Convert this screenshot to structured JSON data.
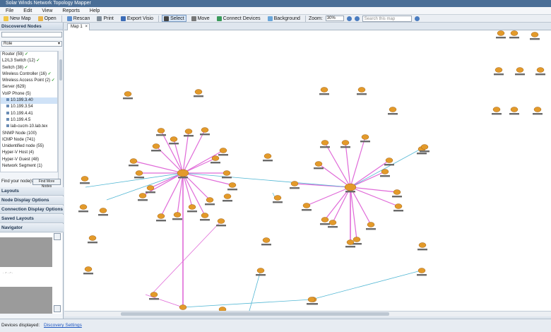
{
  "app": {
    "title": "Solar Winds Network Topology Mapper"
  },
  "menu": [
    "File",
    "Edit",
    "View",
    "Reports",
    "Help"
  ],
  "toolbar": {
    "new_map": "New Map",
    "open": "Open",
    "rescan": "Rescan",
    "print": "Print",
    "export_visio": "Export Visio",
    "select": "Select",
    "move": "Move",
    "connect_devices": "Connect Devices",
    "background": "Background",
    "zoom_label": "Zoom:",
    "zoom_value": "30%",
    "search_placeholder": "Search this map"
  },
  "sidebar": {
    "discovered_heading": "Discovered Nodes",
    "group_by": "Role",
    "tree": [
      {
        "label": "Router (59)",
        "checked": true
      },
      {
        "label": "L2/L3 Switch (12)",
        "checked": true
      },
      {
        "label": "Switch (38)",
        "checked": true
      },
      {
        "label": "Wireless Controller (16)",
        "checked": true
      },
      {
        "label": "Wireless Access Point (2)",
        "checked": true
      },
      {
        "label": "Server (629)",
        "checked": false
      },
      {
        "label": "VoIP Phone (5)",
        "checked": false
      }
    ],
    "voip_children": [
      "10.199.3.40",
      "10.199.3.54",
      "10.199.4.41",
      "10.199.4.5",
      "lab-cucm-10.lab.tex"
    ],
    "tree_more": [
      {
        "label": "SNMP Node (100)"
      },
      {
        "label": "ICMP Node (741)"
      },
      {
        "label": "Unidentified node (55)"
      },
      {
        "label": "Hyper-V Host (4)"
      },
      {
        "label": "Hyper-V Guest (48)"
      },
      {
        "label": "Network Segment (1)"
      }
    ],
    "find_text": "Find your node(s)?",
    "find_button": "Find More Nodes",
    "sections": [
      "Layouts",
      "Node Display Options",
      "Connection Display Options",
      "Saved Layouts"
    ],
    "navigator": "Navigator",
    "navigator_note": "· ·° · ·° ·"
  },
  "tabs": [
    {
      "label": "Map 1"
    }
  ],
  "status": {
    "text": "Devices displayed:",
    "link": "Discovery Settings"
  },
  "colors": {
    "router": "#e39a2a",
    "wireless_link": "#e06ad8",
    "ethernet_link": "#52b7d4",
    "accent": "#4a6e96"
  }
}
